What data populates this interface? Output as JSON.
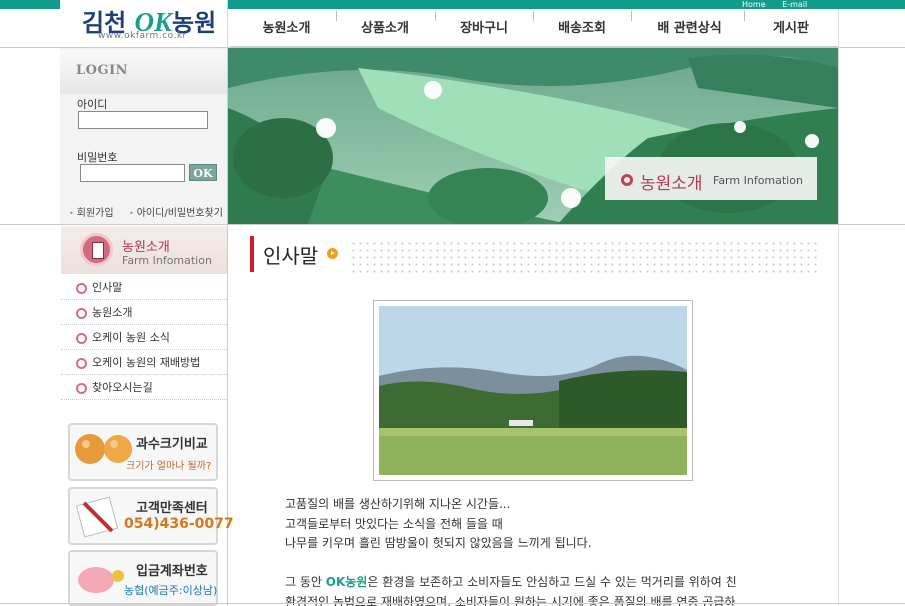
{
  "header": {
    "logo_prefix": "김천",
    "logo_ok": "OK",
    "logo_suffix": "농원",
    "logo_url": "www.okfarm.co.kr",
    "util_links": [
      "Home",
      "E-mail"
    ]
  },
  "nav": {
    "items": [
      "농원소개",
      "상품소개",
      "장바구니",
      "배송조회",
      "배 관련상식",
      "게시판"
    ]
  },
  "login": {
    "title": "LOGIN",
    "id_label": "아이디",
    "pw_label": "비밀번호",
    "ok_button": "OK",
    "join_link": "회원가입",
    "find_link": "아이디/비밀번호찾기"
  },
  "hero": {
    "title": "농원소개",
    "subtitle": "Farm Infomation"
  },
  "sidebar": {
    "title": "농원소개",
    "subtitle": "Farm Infomation",
    "items": [
      "인사말",
      "농원소개",
      "오케이 농원 소식",
      "오케이 농원의 재배방법",
      "찾아오시는길"
    ]
  },
  "banners": [
    {
      "title": "과수크기비교",
      "sub": "크기가 얼마나 될까?",
      "icon": "pear-icon"
    },
    {
      "title": "고객만족센터",
      "sub": "054)436-0077",
      "icon": "pen-paper-icon"
    },
    {
      "title": "입금계좌번호",
      "sub": "농협(예금주:이상남)",
      "icon": "piggy-bank-icon"
    }
  ],
  "content": {
    "title": "인사말",
    "lines": [
      "고품질의 배를 생산하기위해 지나온 시간들...",
      "고객들로부터 맛있다는 소식을 전해 들을 때",
      "나무를 키우며 흘린 땀방울이 헛되지 않았음을 느끼게 됩니다."
    ],
    "line4_pre": "그 동안 ",
    "line4_brand": "OK농원",
    "line4_post": "은 환경을 보존하고 소비자들도 안심하고 드실 수 있는 먹거리를 위하여 친",
    "line5": "환경적인 농법으로 재배하였으며, 소비자들이 원하는 시기에 좋은 품질의 배를 연중 공급하"
  },
  "colors": {
    "brand_teal": "#119c8c",
    "accent_red": "#d81b2c",
    "pink": "#b73a55"
  }
}
